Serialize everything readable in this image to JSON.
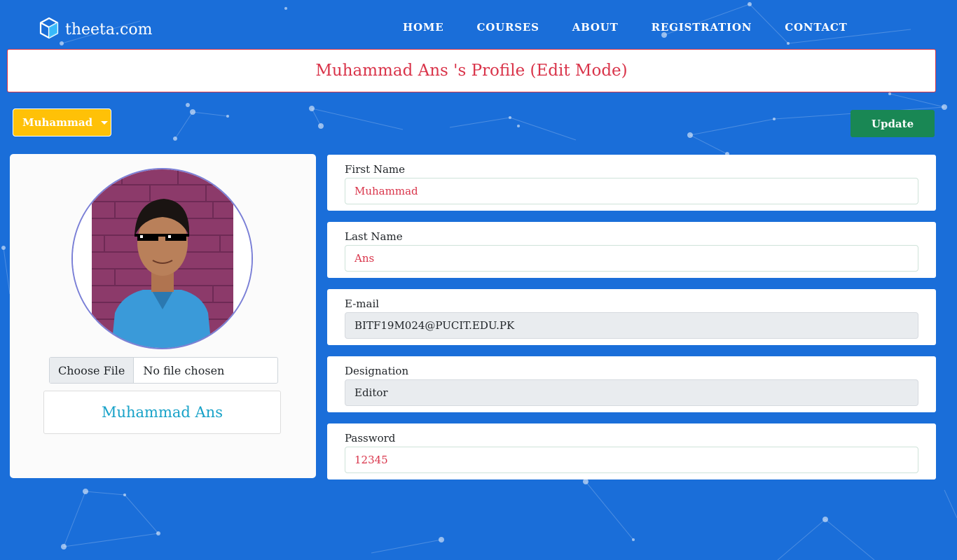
{
  "brand": {
    "name": "theeta.com",
    "icon": "cube-icon"
  },
  "nav": {
    "items": [
      {
        "label": "HOME"
      },
      {
        "label": "COURSES"
      },
      {
        "label": "ABOUT"
      },
      {
        "label": "REGISTRATION"
      },
      {
        "label": "CONTACT"
      }
    ]
  },
  "header": {
    "title": "Muhammad Ans 's Profile (Edit Mode)"
  },
  "toolbar": {
    "dropdown_label": "Muhammad",
    "update_label": "Update"
  },
  "profile": {
    "file_button": "Choose File",
    "file_status": "No file chosen",
    "display_name": "Muhammad Ans"
  },
  "form": {
    "fields": [
      {
        "label": "First Name",
        "value": "Muhammad",
        "readonly": false
      },
      {
        "label": "Last Name",
        "value": "Ans",
        "readonly": false
      },
      {
        "label": "E-mail",
        "value": "BITF19M024@PUCIT.EDU.PK",
        "readonly": true
      },
      {
        "label": "Designation",
        "value": "Editor",
        "readonly": true
      },
      {
        "label": "Password",
        "value": "12345",
        "readonly": false
      }
    ]
  },
  "colors": {
    "background": "#1a6ed9",
    "title_text": "#d9344a",
    "dropdown": "#ffc107",
    "update_button": "#198754",
    "name_text": "#17a2c8"
  }
}
